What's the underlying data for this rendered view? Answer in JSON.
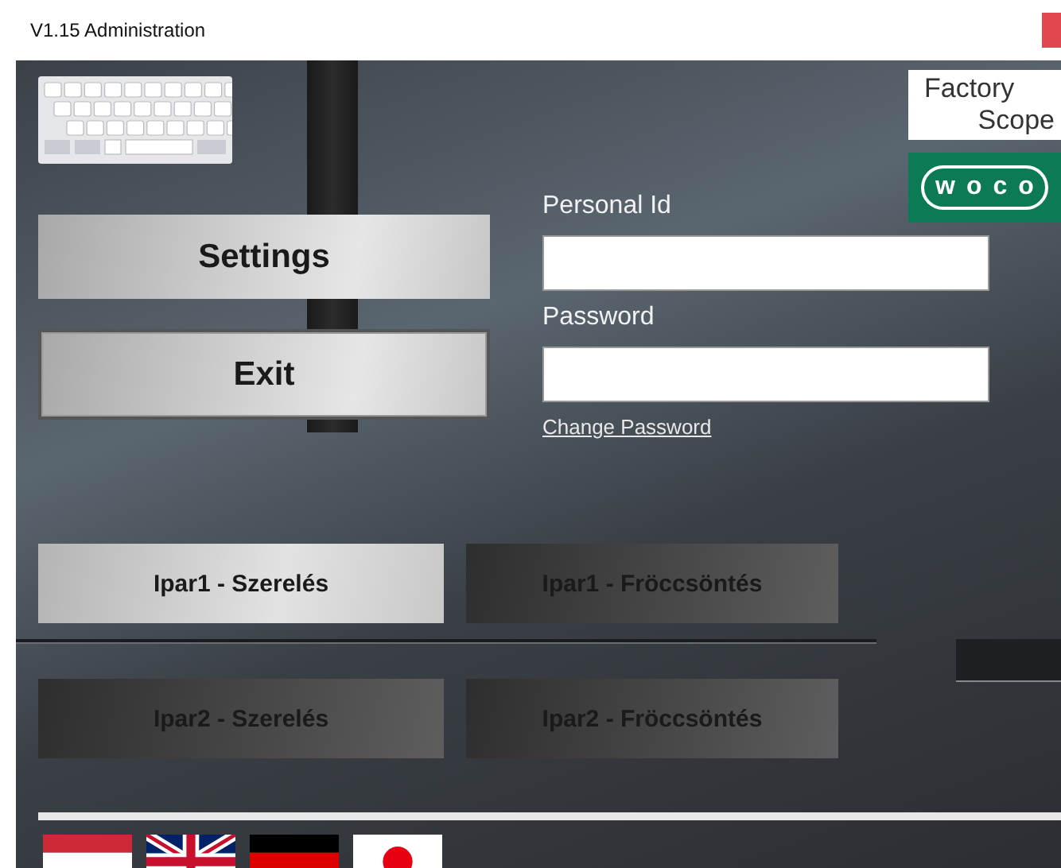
{
  "window": {
    "title": "V1.15 Administration"
  },
  "logos": {
    "product_lines": [
      "Factory",
      "Scope"
    ],
    "brand": "woco"
  },
  "actions": [
    {
      "label": "Settings",
      "focused": false
    },
    {
      "label": "Exit",
      "focused": true
    }
  ],
  "login": {
    "fields": [
      {
        "label": "Personal Id"
      },
      {
        "label": "Password"
      }
    ],
    "link": "Change Password"
  },
  "plants": [
    {
      "label": "Ipar1 - Szerelés",
      "selected": true
    },
    {
      "label": "Ipar1 - Fröccsöntés",
      "selected": false
    },
    {
      "label": "Ipar2 - Szerelés",
      "selected": false
    },
    {
      "label": "Ipar2 - Fröccsöntés",
      "selected": false
    }
  ],
  "languages": [
    {
      "kind": "hu"
    },
    {
      "kind": "gb"
    },
    {
      "kind": "de"
    },
    {
      "kind": "jp"
    }
  ]
}
